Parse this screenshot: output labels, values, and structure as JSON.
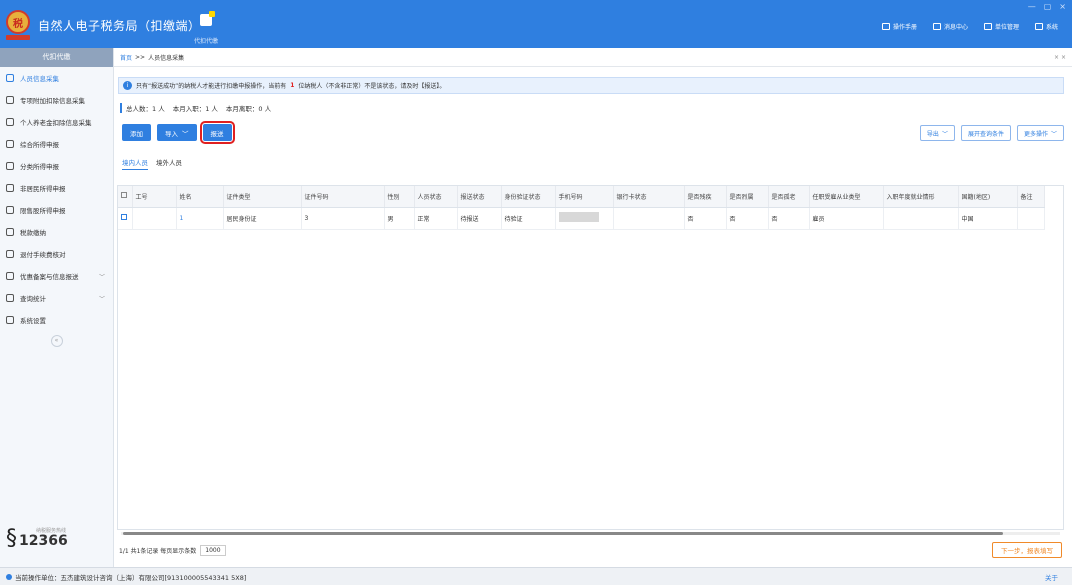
{
  "header": {
    "app_title": "自然人电子税务局（扣缴端）",
    "nav_label": "代扣代缴",
    "links": [
      {
        "label": "操作手册",
        "icon": "manual-icon"
      },
      {
        "label": "消息中心",
        "icon": "message-icon"
      },
      {
        "label": "单位管理",
        "icon": "company-icon"
      },
      {
        "label": "系统",
        "icon": "system-icon"
      }
    ],
    "window_controls": [
      "—",
      "▢",
      "×"
    ]
  },
  "sidebar": {
    "header": "代扣代缴",
    "items": [
      {
        "label": "人员信息采集",
        "active": true
      },
      {
        "label": "专项附加扣除信息采集"
      },
      {
        "label": "个人养老金扣除信息采集"
      },
      {
        "label": "综合所得申报"
      },
      {
        "label": "分类所得申报"
      },
      {
        "label": "非居民所得申报"
      },
      {
        "label": "限售股所得申报"
      },
      {
        "label": "税款缴纳"
      },
      {
        "label": "退付手续费核对"
      },
      {
        "label": "优惠备案与信息报送",
        "expand": "﹀"
      },
      {
        "label": "查询统计",
        "expand": "﹀"
      },
      {
        "label": "系统设置"
      }
    ],
    "collapse": "«",
    "hotline_label": "纳税服务热线",
    "hotline": "12366"
  },
  "breadcrumb": {
    "home": "首页",
    "sep": ">>",
    "current": "人员信息采集",
    "close": "× ×"
  },
  "notice": {
    "pre": "只有“报送成功”的纳税人才能进行扣缴申报操作，当前有",
    "count": "1",
    "post": "位纳税人（不含非正常）不是该状态，请及时【报送】。"
  },
  "stats": {
    "total": "总人数：1 人",
    "joined": "本月入职：1 人",
    "left": "本月离职：0 人"
  },
  "toolbar": {
    "add": "添加",
    "import": "导入",
    "submit": "报送"
  },
  "right_tools": {
    "export": "导出",
    "expand": "展开查询条件",
    "more": "更多操作"
  },
  "tabs": [
    "境内人员",
    "境外人员"
  ],
  "table": {
    "headers": [
      "工号",
      "姓名",
      "证件类型",
      "证件号码",
      "性别",
      "人员状态",
      "报送状态",
      "身份验证状态",
      "手机号码",
      "银行卡状态",
      "是否残疾",
      "是否烈属",
      "是否孤老",
      "任职受雇从业类型",
      "入职年度就业情形",
      "国籍(地区)",
      "备注"
    ],
    "rows": [
      [
        "",
        "1",
        "居民身份证",
        "3",
        "男",
        "正常",
        "待报送",
        "待验证",
        "",
        "",
        "否",
        "否",
        "否",
        "雇员",
        "",
        "中国",
        ""
      ]
    ]
  },
  "pager": {
    "info": "1/1 共1条记录 每页显示条数",
    "page_size": "1000"
  },
  "next_button": "下一步，报表填写",
  "status_bar": {
    "unit": "当前操作单位：五杰建筑设计咨询（上海）有限公司[913100005543341 5X8]",
    "about": "关于"
  }
}
